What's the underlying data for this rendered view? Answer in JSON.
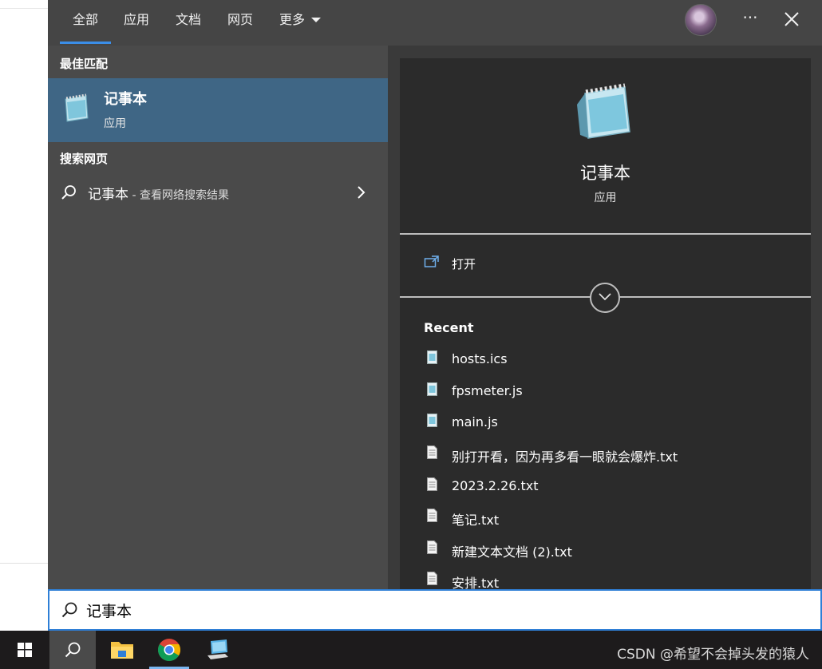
{
  "tabs": [
    {
      "label": "全部"
    },
    {
      "label": "应用"
    },
    {
      "label": "文档"
    },
    {
      "label": "网页"
    },
    {
      "label": "更多"
    }
  ],
  "header": {
    "more_icon": "···"
  },
  "left": {
    "best_match_heading": "最佳匹配",
    "best_match": {
      "name": "记事本",
      "type": "应用"
    },
    "web_heading": "搜索网页",
    "web_result": {
      "query": "记事本",
      "suffix": " - 查看网络搜索结果"
    }
  },
  "detail": {
    "name": "记事本",
    "type": "应用",
    "open_label": "打开",
    "recent_heading": "Recent",
    "recent_files": [
      {
        "name": "hosts.ics",
        "icon": "notepad-file-icon"
      },
      {
        "name": "fpsmeter.js",
        "icon": "notepad-file-icon"
      },
      {
        "name": "main.js",
        "icon": "notepad-file-icon"
      },
      {
        "name": "别打开看，因为再多看一眼就会爆炸.txt",
        "icon": "text-file-icon"
      },
      {
        "name": "2023.2.26.txt",
        "icon": "text-file-icon"
      },
      {
        "name": "笔记.txt",
        "icon": "text-file-icon"
      },
      {
        "name": "新建文本文档 (2).txt",
        "icon": "text-file-icon"
      },
      {
        "name": "安排.txt",
        "icon": "text-file-icon"
      }
    ]
  },
  "search": {
    "value": "记事本"
  },
  "taskbar": {
    "watermark": "CSDN @希望不会掉头发的猿人"
  },
  "colors": {
    "accent": "#3b8ee8",
    "selected": "#3f6685",
    "taskbar": "#1d1b1c"
  }
}
